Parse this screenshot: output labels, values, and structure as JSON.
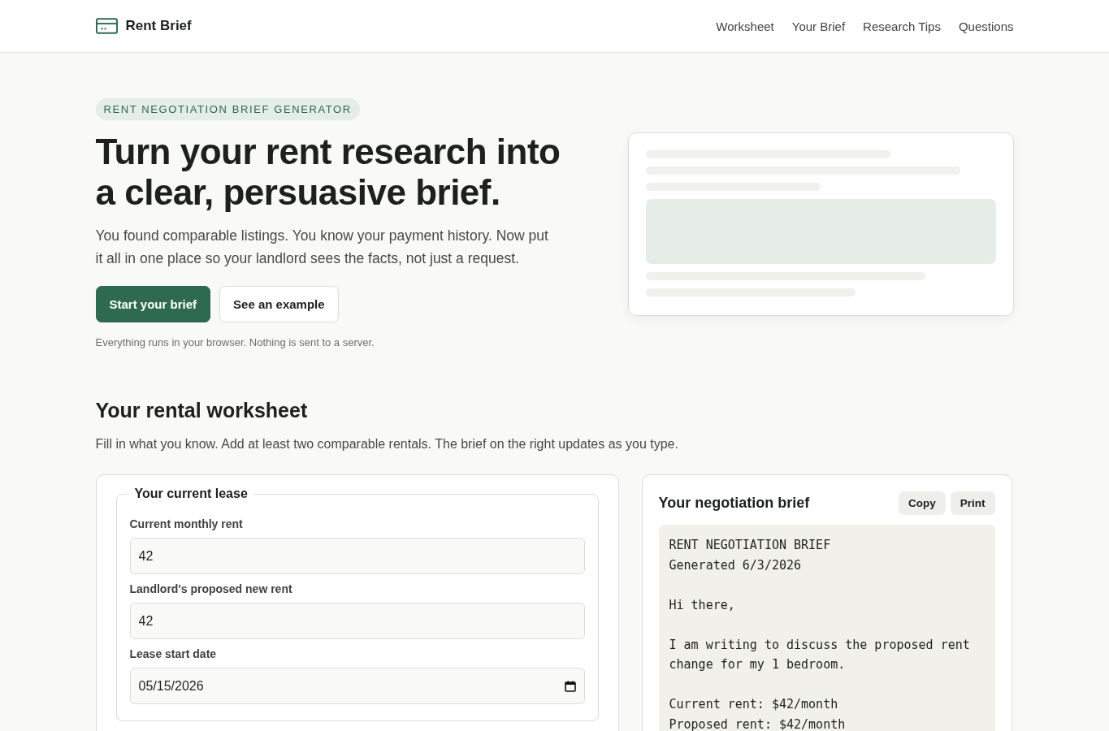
{
  "header": {
    "brand": "Rent Brief",
    "nav": [
      {
        "label": "Worksheet"
      },
      {
        "label": "Your Brief"
      },
      {
        "label": "Research Tips"
      },
      {
        "label": "Questions"
      }
    ]
  },
  "hero": {
    "eyebrow": "RENT NEGOTIATION BRIEF GENERATOR",
    "title": "Turn your rent research into a clear, persuasive brief.",
    "lead": "You found comparable listings. You know your payment history. Now put it all in one place so your landlord sees the facts, not just a request.",
    "buttons": [
      {
        "label": "Start your brief",
        "kind": "primary"
      },
      {
        "label": "See an example",
        "kind": "secondary"
      }
    ],
    "note": "Everything runs in your browser. Nothing is sent to a server."
  },
  "worksheet": {
    "title": "Your rental worksheet",
    "intro": "Fill in what you know. Add at least two comparable rentals. The brief on the right updates as you type.",
    "lease": {
      "legend": "Your current lease",
      "fields": [
        {
          "label": "Current monthly rent",
          "value": "42",
          "kind": "number"
        },
        {
          "label": "Landlord's proposed new rent",
          "value": "42",
          "kind": "number"
        },
        {
          "label": "Lease start date",
          "value": "05/15/2026",
          "kind": "date"
        }
      ]
    },
    "brief": {
      "title": "Your negotiation brief",
      "actions": [
        "Copy",
        "Print"
      ],
      "paragraphs": [
        [
          "RENT NEGOTIATION BRIEF",
          "Generated 6/3/2026"
        ],
        [
          "Hi there,"
        ],
        [
          "I am writing to discuss the proposed rent change for my 1 bedroom."
        ],
        [
          "Current rent: $42/month",
          "Proposed rent: $42/month"
        ]
      ]
    }
  }
}
